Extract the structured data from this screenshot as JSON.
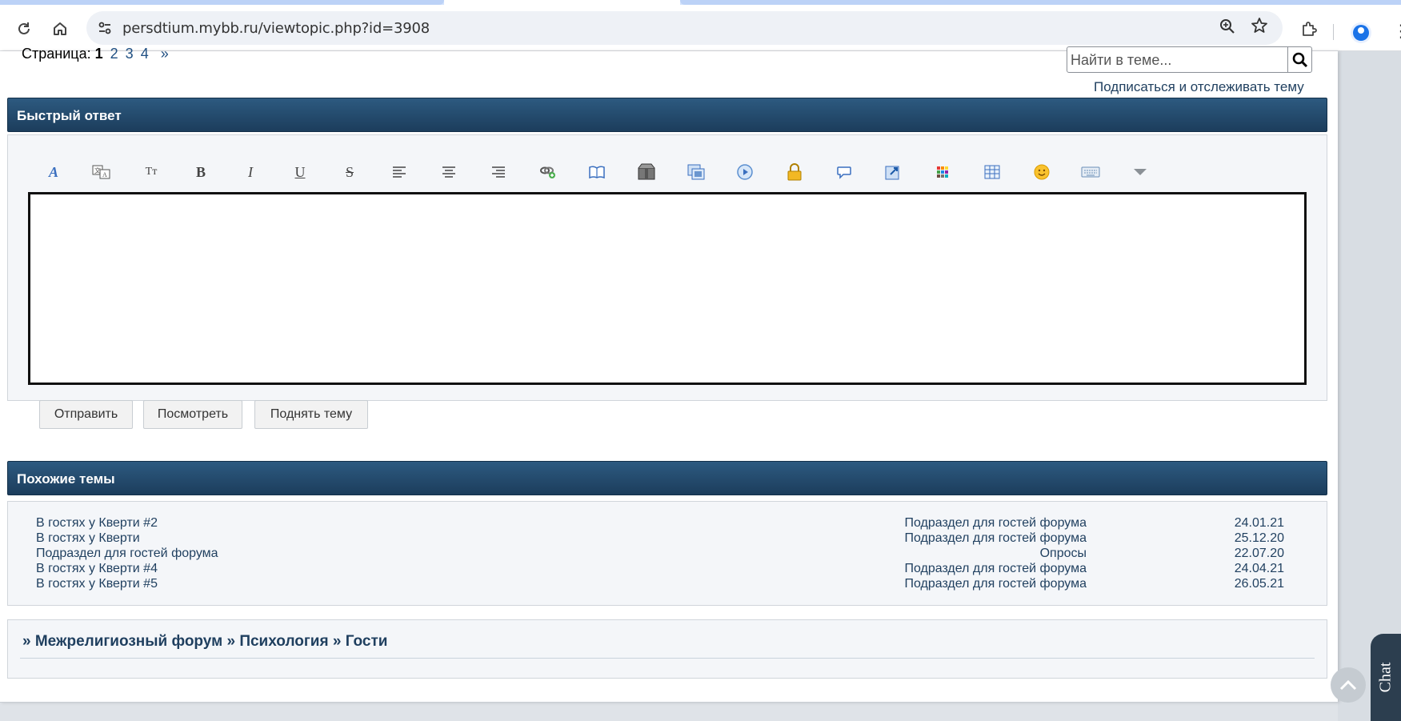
{
  "browser": {
    "url": "persdtium.mybb.ru/viewtopic.php?id=3908",
    "icons": [
      "reload-icon",
      "home-icon",
      "site-settings-icon",
      "zoom-icon",
      "bookmark-star-icon",
      "extensions-icon",
      "profile-icon",
      "menu-icon"
    ]
  },
  "page": {
    "pagination": {
      "label": "Страница:",
      "current": "1",
      "pages": [
        "2",
        "3",
        "4"
      ],
      "next": "»"
    },
    "search": {
      "placeholder": "Найти в теме...",
      "button_icon": "search-icon"
    },
    "subscribe_link": "Подписаться и отслеживать тему",
    "quick_reply": {
      "title": "Быстрый ответ",
      "toolbar_icons": [
        "font-color-icon",
        "translate-icon",
        "font-size-icon",
        "bold-icon",
        "italic-icon",
        "underline-icon",
        "strikethrough-icon",
        "align-left-icon",
        "align-center-icon",
        "align-right-icon",
        "link-icon",
        "book-icon",
        "box-icon",
        "image-icon",
        "video-icon",
        "lock-icon",
        "quote-bubble-icon",
        "code-icon",
        "color-grid-icon",
        "table-icon",
        "smiley-icon",
        "keyboard-icon",
        "more-dropdown-icon"
      ],
      "text": "",
      "buttons": {
        "submit": "Отправить",
        "preview": "Посмотреть",
        "bump": "Поднять тему"
      }
    },
    "similar": {
      "title": "Похожие темы",
      "rows": [
        {
          "topic": "В гостях у Кверти #2",
          "forum": "Подраздел для гостей форума",
          "date": "24.01.21"
        },
        {
          "topic": "В гостях у Кверти",
          "forum": "Подраздел для гостей форума",
          "date": "25.12.20"
        },
        {
          "topic": "Подраздел для гостей форума",
          "forum": "Опросы",
          "date": "22.07.20"
        },
        {
          "topic": "В гостях у Кверти #4",
          "forum": "Подраздел для гостей форума",
          "date": "24.04.21"
        },
        {
          "topic": "В гостях у Кверти #5",
          "forum": "Подраздел для гостей форума",
          "date": "26.05.21"
        }
      ]
    },
    "breadcrumb": {
      "sep": "»",
      "items": [
        "Межрелигиозный форум",
        "Психология"
      ],
      "current": "Гости"
    },
    "chat_label": "Chat"
  }
}
